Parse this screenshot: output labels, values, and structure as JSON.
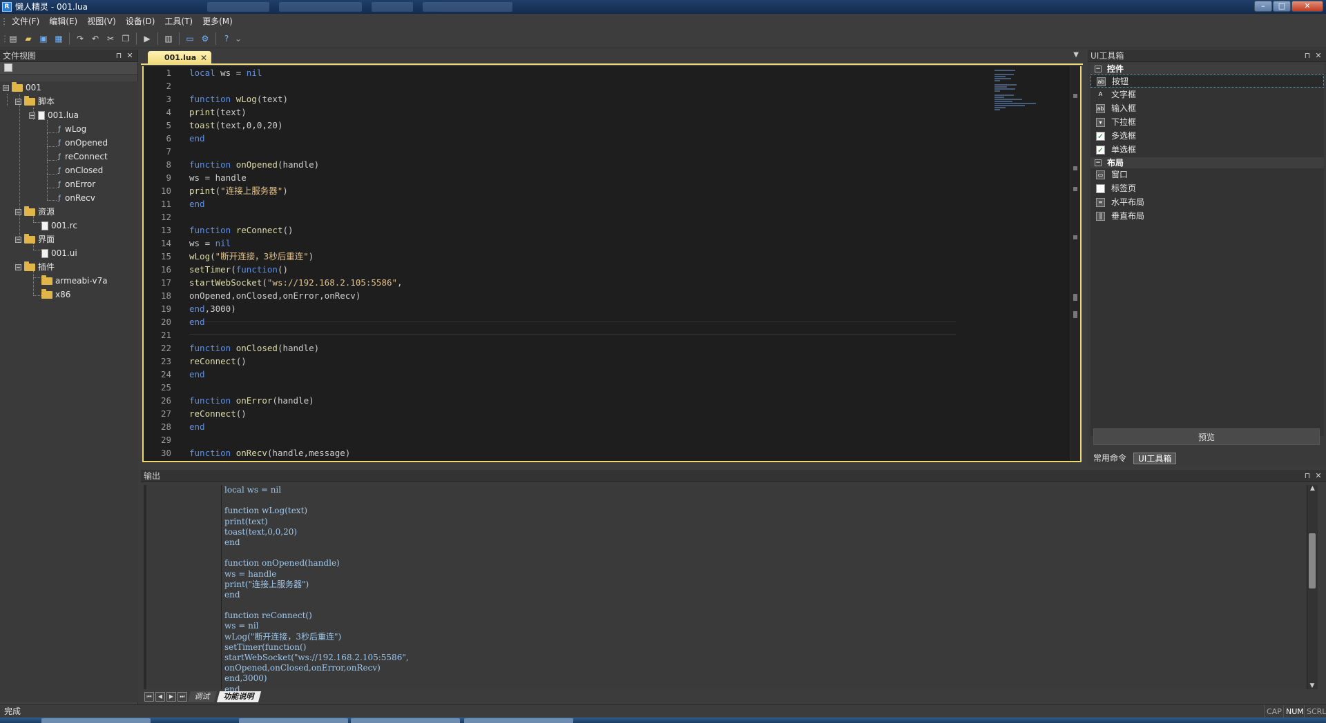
{
  "window": {
    "title": "懒人精灵 - 001.lua",
    "app_icon": "R",
    "controls": {
      "minimize": "–",
      "maximize": "□",
      "close": "✕"
    }
  },
  "menu": [
    "文件(F)",
    "编辑(E)",
    "视图(V)",
    "设备(D)",
    "工具(T)",
    "更多(M)"
  ],
  "file_view": {
    "title": "文件视图",
    "tree": {
      "root": "001",
      "scripts": {
        "label": "脚本",
        "file": "001.lua",
        "functions": [
          "wLog",
          "onOpened",
          "reConnect",
          "onClosed",
          "onError",
          "onRecv"
        ]
      },
      "resources": {
        "label": "资源",
        "file": "001.rc"
      },
      "ui": {
        "label": "界面",
        "file": "001.ui"
      },
      "plugins": {
        "label": "插件",
        "folders": [
          "armeabi-v7a",
          "x86"
        ]
      }
    }
  },
  "editor": {
    "tab": "001.lua",
    "lines": [
      "1",
      "2",
      "3",
      "4",
      "5",
      "6",
      "7",
      "8",
      "9",
      "10",
      "11",
      "12",
      "13",
      "14",
      "15",
      "16",
      "17",
      "18",
      "19",
      "20",
      "21",
      "22",
      "23",
      "24",
      "25",
      "26",
      "27",
      "28",
      "29",
      "30"
    ]
  },
  "toolbox": {
    "title": "UI工具箱",
    "group_controls": "控件",
    "controls": [
      "按钮",
      "文字框",
      "输入框",
      "下拉框",
      "多选框",
      "单选框"
    ],
    "group_layout": "布局",
    "layouts": [
      "窗口",
      "标签页",
      "水平布局",
      "垂直布局"
    ],
    "preview": "预览",
    "tabs": [
      "常用命令",
      "UI工具箱"
    ]
  },
  "output": {
    "title": "输出",
    "lines": [
      "local ws = nil",
      "",
      "function wLog(text)",
      "print(text)",
      "toast(text,0,0,20)",
      "end",
      "",
      "function onOpened(handle)",
      "ws = handle",
      "print(\"连接上服务器\")",
      "end",
      "",
      "function reConnect()",
      "ws = nil",
      "wLog(\"断开连接，3秒后重连\")",
      "setTimer(function()",
      "startWebSocket(\"ws://192.168.2.105:5586\",",
      "onOpened,onClosed,onError,onRecv)",
      "end,3000)",
      "end"
    ],
    "tabs": [
      "调试",
      "功能说明"
    ]
  },
  "status": {
    "text": "完成",
    "indicators": [
      "CAP",
      "NUM",
      "SCRL"
    ]
  }
}
